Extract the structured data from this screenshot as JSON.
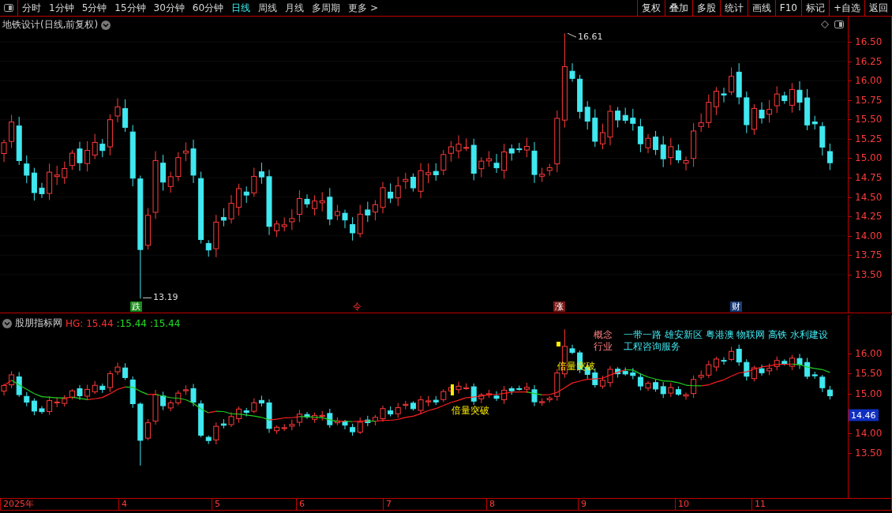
{
  "toolbar": {
    "periods": [
      {
        "label": "分时",
        "selected": false
      },
      {
        "label": "1分钟",
        "selected": false
      },
      {
        "label": "5分钟",
        "selected": false
      },
      {
        "label": "15分钟",
        "selected": false
      },
      {
        "label": "30分钟",
        "selected": false
      },
      {
        "label": "60分钟",
        "selected": false
      },
      {
        "label": "日线",
        "selected": true
      },
      {
        "label": "周线",
        "selected": false
      },
      {
        "label": "月线",
        "selected": false
      },
      {
        "label": "多周期",
        "selected": false
      },
      {
        "label": "更多 >",
        "selected": false
      }
    ],
    "actions": [
      "复权",
      "叠加",
      "多股",
      "统计",
      "画线",
      "F10",
      "标记",
      "+自选",
      "返回"
    ]
  },
  "main_pane": {
    "title": "地铁设计(日线,前复权)",
    "yticks": [
      "16.50",
      "16.25",
      "16.00",
      "15.75",
      "15.50",
      "15.25",
      "15.00",
      "14.75",
      "14.50",
      "14.25",
      "14.00",
      "13.75",
      "13.50"
    ],
    "high_label": "16.61",
    "low_label": "13.19",
    "event_marks": [
      {
        "label": "跌",
        "color": "#1a8a1a"
      },
      {
        "label": "令",
        "color": "#000000"
      },
      {
        "label": "涨",
        "color": "#7a1a1a"
      },
      {
        "label": "财",
        "color": "#1a3a7a"
      }
    ]
  },
  "indicator_pane": {
    "name": "股朋指标网",
    "readings": [
      {
        "text": "HG: 15.44",
        "color": "#ff3030"
      },
      {
        "text": ":15.44",
        "color": "#20e020"
      },
      {
        "text": ":15.44",
        "color": "#20e020"
      }
    ],
    "signals": [
      "倍量突破",
      "倍量突破"
    ],
    "concept_label": "概念",
    "concepts": "一带一路 雄安新区 粤港澳 物联网 高铁 水利建设",
    "industry_label": "行业",
    "industry": "工程咨询服务",
    "yticks": [
      "16.00",
      "15.50",
      "15.00",
      "14.00",
      "13.50"
    ],
    "last_price": "14.46"
  },
  "time_axis": [
    "2025年",
    "4",
    "5",
    "6",
    "7",
    "8",
    "9",
    "10",
    "11"
  ]
}
